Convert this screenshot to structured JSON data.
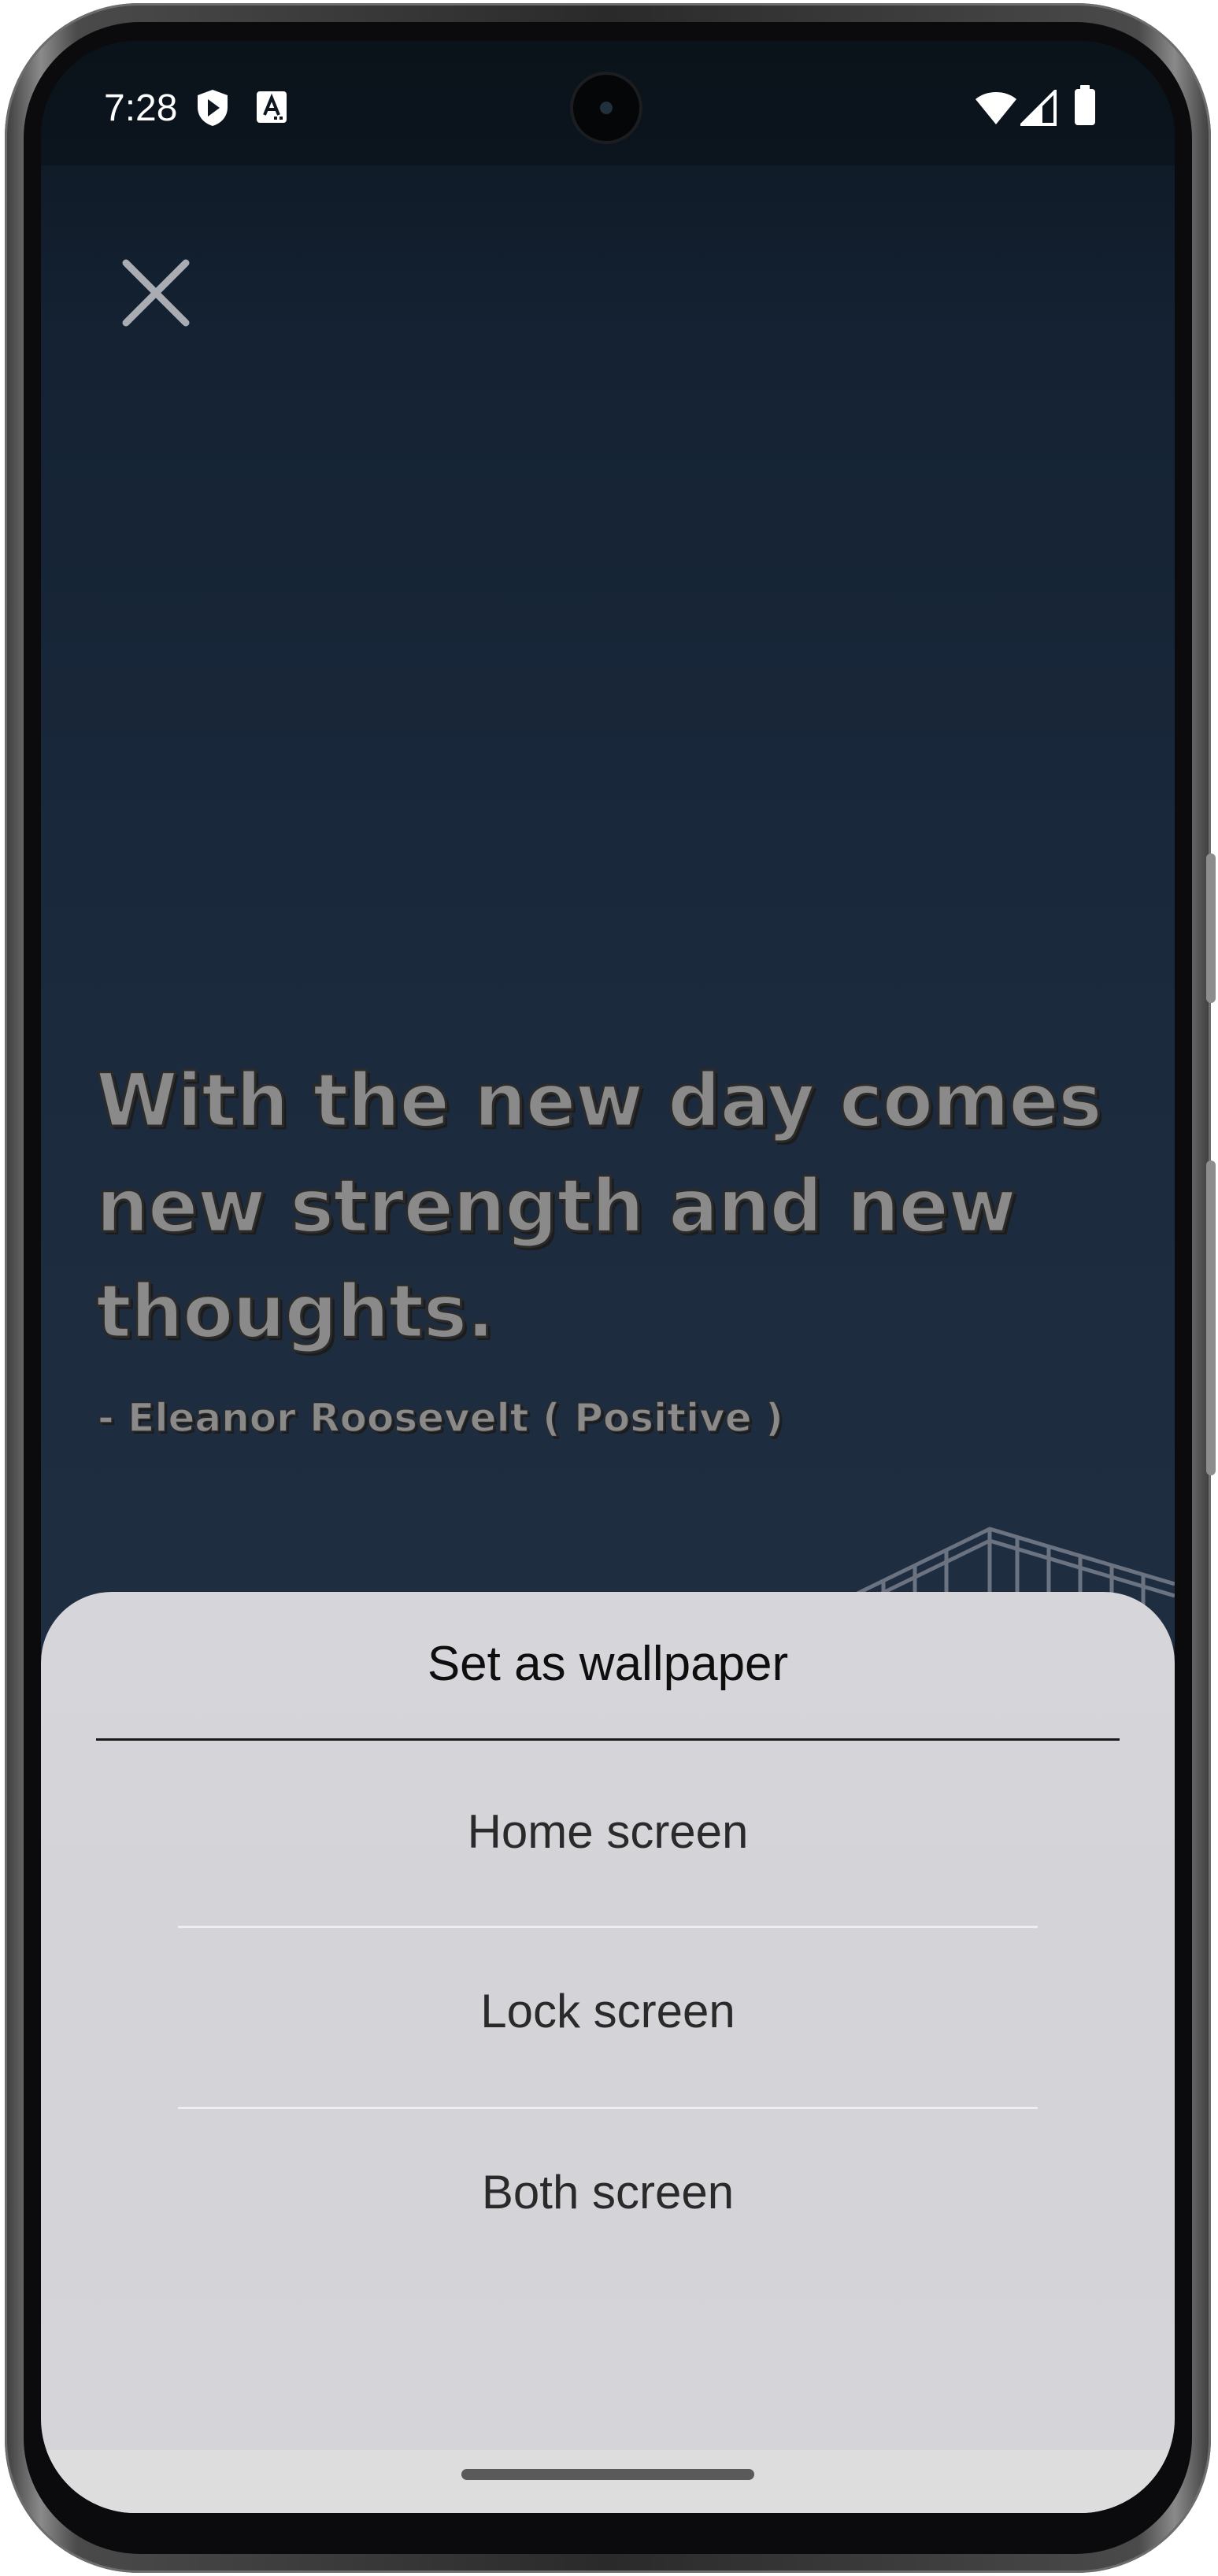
{
  "status_bar": {
    "time": "7:28",
    "left_icons": [
      "shield-play-icon",
      "text-a-icon"
    ],
    "right_icons": [
      "wifi-icon",
      "cell-signal-icon",
      "battery-icon"
    ]
  },
  "header": {
    "close_icon": "close-icon"
  },
  "quote": {
    "text": "With the new day comes new strength and new thoughts.",
    "attribution": "- Eleanor Roosevelt ( Positive )"
  },
  "sheet": {
    "title": "Set as wallpaper",
    "options": [
      {
        "label": "Home screen"
      },
      {
        "label": "Lock screen"
      },
      {
        "label": "Both screen"
      }
    ]
  },
  "colors": {
    "background_top": "#0d1620",
    "background_bottom": "#1e2b3e",
    "sheet_bg": "#d4d4d9",
    "quote_text": "#8a8a8a"
  }
}
